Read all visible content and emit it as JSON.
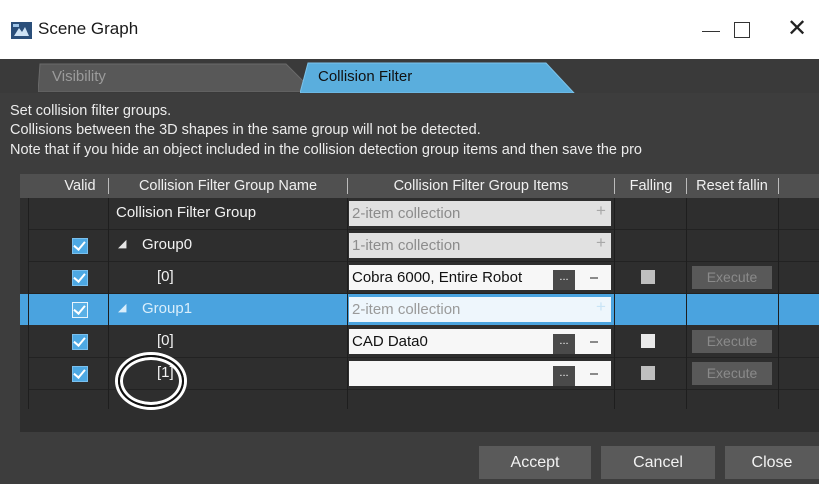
{
  "window": {
    "title": "Scene Graph",
    "icon": "scene-graph-app-icon",
    "close_glyph": "✕"
  },
  "tabs": [
    {
      "label": "Visibility",
      "active": false
    },
    {
      "label": "Collision Filter",
      "active": true
    }
  ],
  "description": [
    "Set collision filter groups.",
    "Collisions between the 3D shapes in the same group will not be detected.",
    "Note that if you hide an object included in the collision detection group items and then save the pro"
  ],
  "grid": {
    "columns": [
      "Valid",
      "Collision Filter Group Name",
      "Collision Filter Group Items",
      "Falling",
      "Reset fallin"
    ],
    "rows": [
      {
        "checked": false,
        "expander": "",
        "name": "Collision Filter Group",
        "items": "2-item collection",
        "items_button": "+",
        "falling": "",
        "reset": ""
      },
      {
        "checked": true,
        "expander": "◢",
        "name": "Group0",
        "items": "1-item collection",
        "items_button": "+",
        "falling": "",
        "reset": ""
      },
      {
        "checked": true,
        "expander": "",
        "name": "[0]",
        "items": "Cobra 6000, Entire Robot",
        "items_button": "...",
        "falling": "unchecked",
        "reset": "Execute"
      },
      {
        "checked": true,
        "expander": "◢",
        "name": "Group1",
        "items": "2-item collection",
        "items_button": "+",
        "falling": "",
        "reset": ""
      },
      {
        "checked": true,
        "expander": "",
        "name": "[0]",
        "items": "CAD Data0",
        "items_button": "...",
        "falling": "unchecked",
        "reset": "Execute"
      },
      {
        "checked": true,
        "expander": "",
        "name": "[1]",
        "items": "",
        "items_button": "...",
        "falling": "unchecked",
        "reset": "Execute"
      }
    ],
    "selected_row": 3
  },
  "buttons": {
    "accept": "Accept",
    "cancel": "Cancel",
    "close": "Close"
  },
  "colors": {
    "accent": "#4aa3df",
    "tab_active": "#5aaedd",
    "background": "#3d3d3d"
  }
}
